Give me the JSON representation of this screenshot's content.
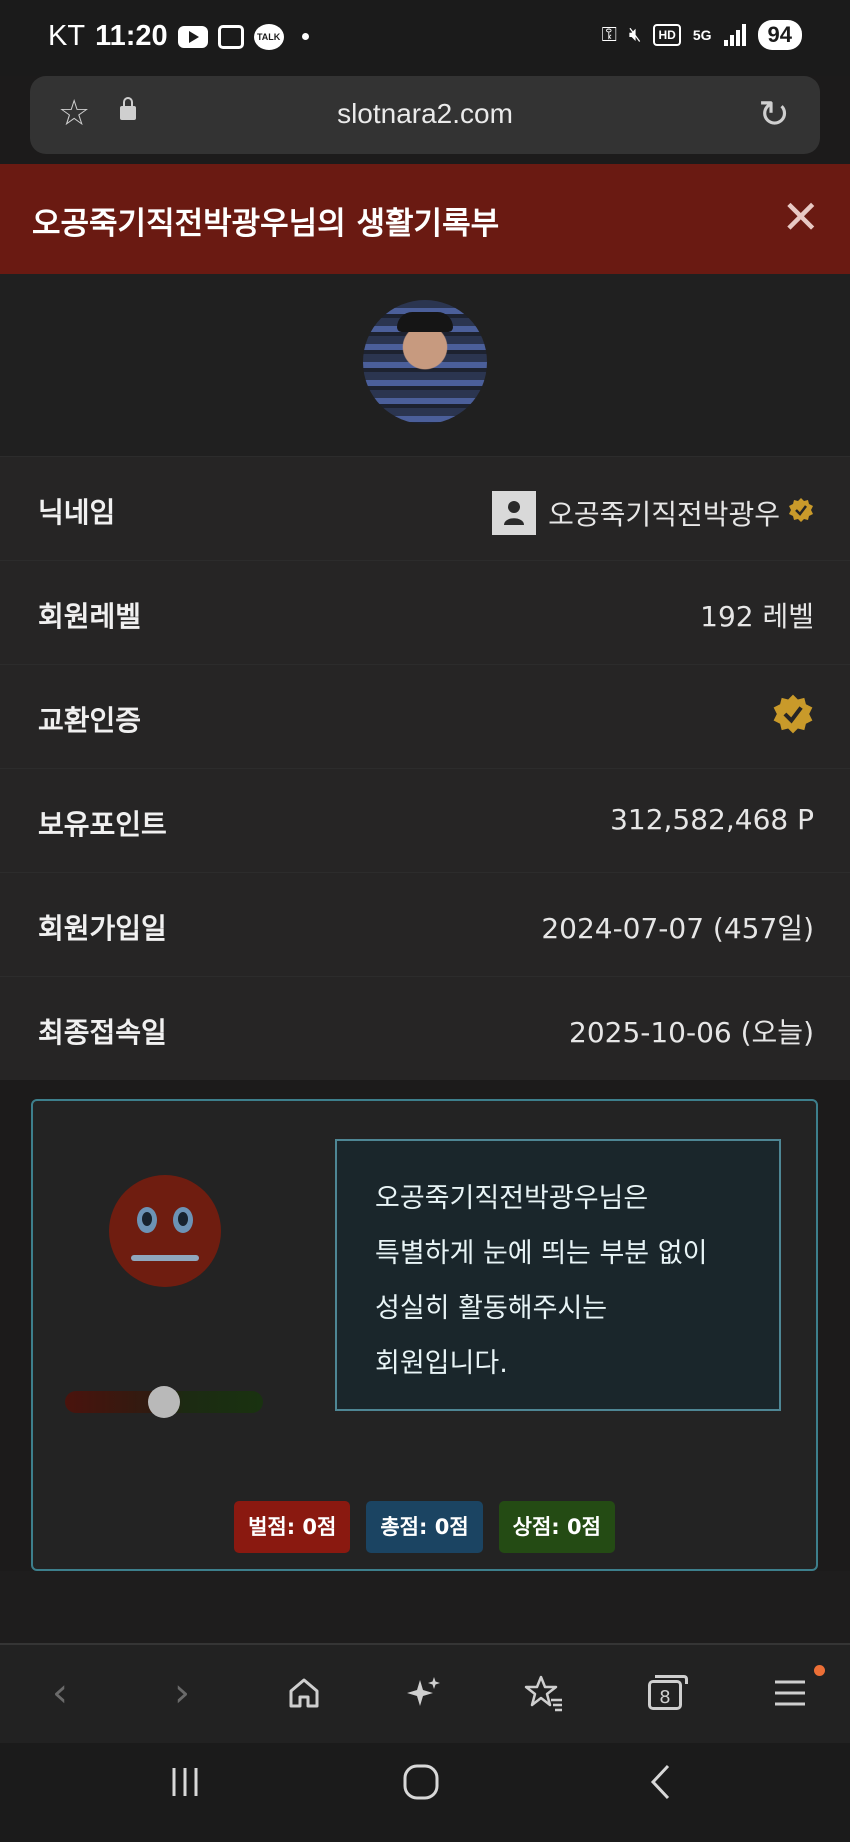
{
  "status_bar": {
    "carrier": "KT",
    "time": "11:20",
    "talk_label": "TALK",
    "hd_label": "HD",
    "network": "5G",
    "battery": "94"
  },
  "browser": {
    "url": "slotnara2.com"
  },
  "modal": {
    "title": "오공죽기직전박광우님의 생활기록부"
  },
  "profile_rows": [
    {
      "label": "닉네임",
      "value": "오공죽기직전박광우"
    },
    {
      "label": "회원레벨",
      "value": "192 레벨"
    },
    {
      "label": "교환인증",
      "value": ""
    },
    {
      "label": "보유포인트",
      "value": "312,582,468 P"
    },
    {
      "label": "회원가입일",
      "value": "2024-07-07 (457일)"
    },
    {
      "label": "최종접속일",
      "value": "2025-10-06 (오늘)"
    }
  ],
  "evaluation": {
    "mood_level": 0.5,
    "message_lines": [
      "오공죽기직전박광우님은",
      "특별하게 눈에 띄는 부분 없이",
      "성실히 활동해주시는",
      "회원입니다."
    ],
    "penalty": "벌점: 0점",
    "total": "총점: 0점",
    "bonus": "상점: 0점"
  },
  "bottom_nav": {
    "tab_count": "8"
  },
  "colors": {
    "title_bg": "#6a1a12",
    "card_border": "#3d7f8c",
    "verify_gold": "#c99a2a"
  }
}
